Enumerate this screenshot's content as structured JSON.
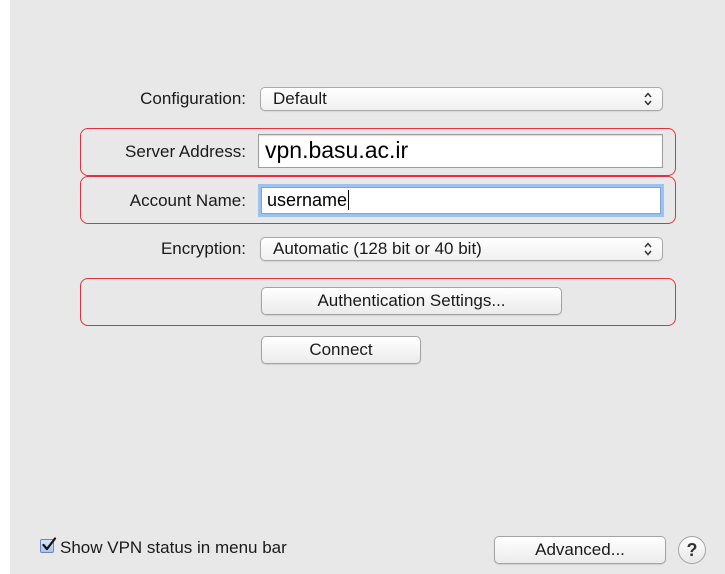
{
  "form": {
    "configuration": {
      "label": "Configuration:",
      "value": "Default"
    },
    "server_address": {
      "label": "Server Address:",
      "value": "vpn.basu.ac.ir"
    },
    "account_name": {
      "label": "Account Name:",
      "value": "username"
    },
    "encryption": {
      "label": "Encryption:",
      "value": "Automatic (128 bit or 40 bit)"
    }
  },
  "buttons": {
    "authentication_settings": "Authentication Settings...",
    "connect": "Connect",
    "advanced": "Advanced...",
    "help": "?"
  },
  "footer": {
    "show_vpn_status_label": "Show VPN status in menu bar",
    "show_vpn_status_checked": true
  },
  "icons": {
    "popup_arrows": "up-down-chevrons-icon",
    "checkmark": "checkmark-icon"
  },
  "colors": {
    "highlight": "#e62e3c",
    "focus_ring": "#9cc3f0",
    "panel_background": "#e8e8e8"
  }
}
